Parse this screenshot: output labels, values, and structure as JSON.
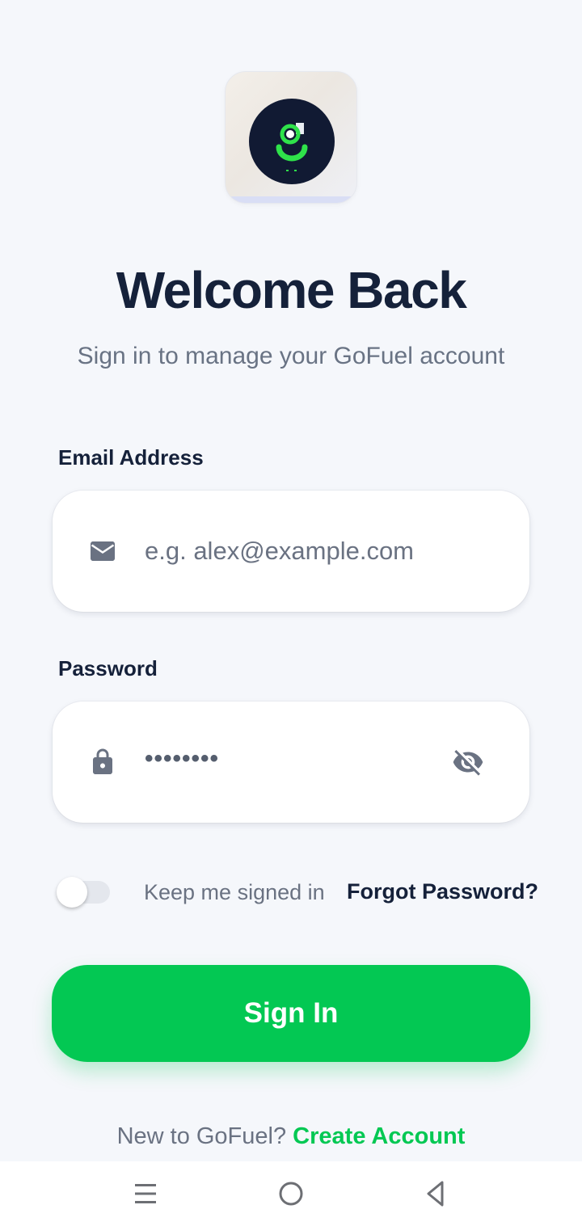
{
  "app": {
    "logo_icon": "gofuel-logo-icon",
    "title": "Welcome Back",
    "subtitle": "Sign in to manage your GoFuel account"
  },
  "form": {
    "email_label": "Email Address",
    "email_placeholder": "e.g. alex@example.com",
    "email_icon": "mail-icon",
    "password_label": "Password",
    "password_value": "••••••••",
    "password_icon": "lock-icon",
    "visibility_icon": "eye-off-icon",
    "keep_signed_in_label": "Keep me signed in",
    "keep_signed_in": false,
    "forgot_password": "Forgot Password?",
    "sign_in_button": "Sign In"
  },
  "footer": {
    "prompt": "New to GoFuel?",
    "create_account": "Create Account"
  },
  "system_nav": {
    "menu_icon": "menu-icon",
    "home_icon": "home-circle-icon",
    "back_icon": "back-triangle-icon"
  },
  "colors": {
    "accent": "#03c853",
    "text_dark": "#15213a",
    "text_muted": "#6a7282",
    "background": "#f5f7fb",
    "logo_bg": "#111a33"
  }
}
